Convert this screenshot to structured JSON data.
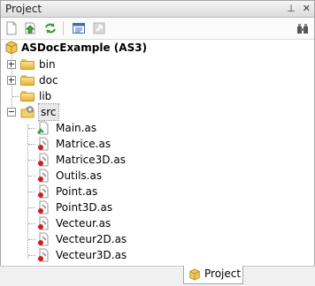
{
  "panel": {
    "title": "Project",
    "pin_glyph": "⊥",
    "close_glyph": "✕"
  },
  "toolbar": {
    "buttons": [
      {
        "name": "new-file-icon"
      },
      {
        "name": "import-icon"
      },
      {
        "name": "refresh-icon"
      },
      {
        "name": "properties-icon"
      },
      {
        "name": "build-icon"
      },
      {
        "name": "tools-icon"
      }
    ]
  },
  "tree": {
    "root": "ASDocExample (AS3)",
    "folders": [
      "bin",
      "doc",
      "lib",
      "src"
    ],
    "files": [
      "Main.as",
      "Matrice.as",
      "Matrice3D.as",
      "Outils.as",
      "Point.as",
      "Point3D.as",
      "Vecteur.as",
      "Vecteur2D.as",
      "Vecteur3D.as"
    ]
  },
  "bottom_tab": {
    "label": "Project"
  },
  "colors": {
    "folder": "#f1c84f",
    "class_red": "#cc2020",
    "main_green": "#2e9b3a"
  }
}
